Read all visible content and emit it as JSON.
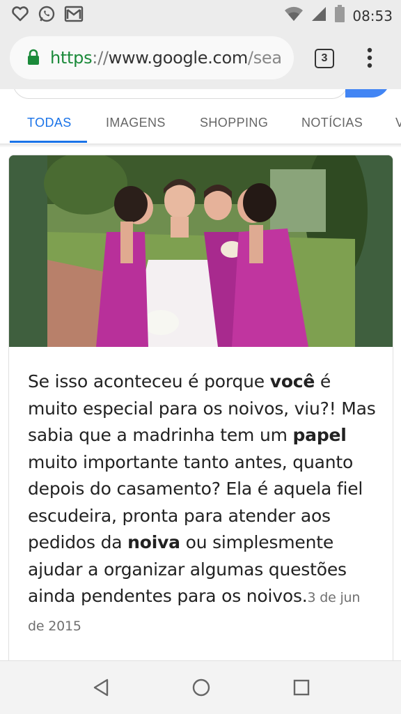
{
  "status_bar": {
    "time": "08:53",
    "left_icons": [
      "heart-outline-icon",
      "whatsapp-icon",
      "gmail-icon"
    ],
    "right_icons": [
      "wifi-icon",
      "signal-icon",
      "battery-icon"
    ]
  },
  "browser": {
    "url_scheme": "https",
    "url_separator": "://",
    "url_host": "www.google.com",
    "url_path": "/sea",
    "tab_count": "3",
    "secure_icon": "lock-icon",
    "menu_icon": "more-vert-icon"
  },
  "search_tabs": [
    {
      "label": "TODAS",
      "active": true
    },
    {
      "label": "IMAGENS",
      "active": false
    },
    {
      "label": "SHOPPING",
      "active": false
    },
    {
      "label": "NOTÍCIAS",
      "active": false
    },
    {
      "label": "V",
      "active": false
    }
  ],
  "result": {
    "image": "bride-with-bridesmaids-photo",
    "snippet": [
      {
        "text": "Se isso aconteceu é porque ",
        "bold": false
      },
      {
        "text": "você",
        "bold": true
      },
      {
        "text": " é muito especial para os noivos, viu?! Mas sabia que a madrinha tem um ",
        "bold": false
      },
      {
        "text": "papel",
        "bold": true
      },
      {
        "text": " muito importante tanto antes, quanto depois do casamento? Ela é aquela fiel escudeira, pronta para atender aos pedidos da ",
        "bold": false
      },
      {
        "text": "noiva",
        "bold": true
      },
      {
        "text": " ou simplesmente ajudar a organizar algumas questões ainda pendentes para os noivos.",
        "bold": false
      }
    ],
    "date": "3 de jun de 2015"
  },
  "nav_bar": {
    "icons": [
      "back-icon",
      "home-icon",
      "recents-icon"
    ]
  },
  "colors": {
    "accent": "#1a73e8",
    "secure_green": "#1b8a3a",
    "dress_magenta": "#b8309a",
    "photo_border_green": "#3f5f3e"
  }
}
